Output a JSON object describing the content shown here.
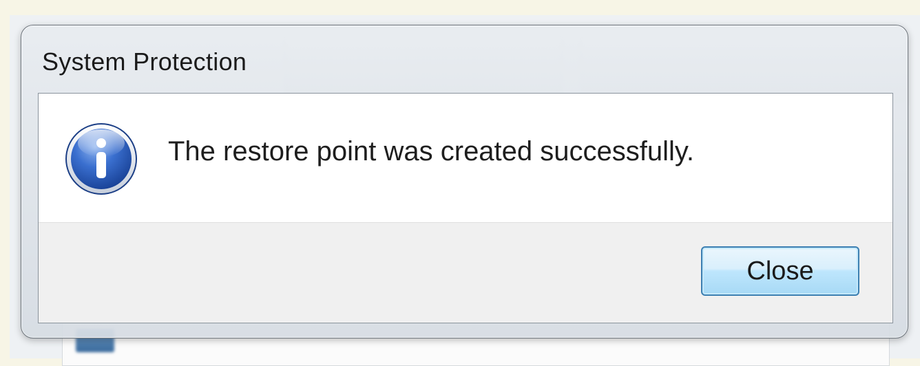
{
  "dialog": {
    "title": "System Protection",
    "message": "The restore point was created successfully.",
    "icon": "info-icon",
    "buttons": {
      "close_label": "Close"
    }
  },
  "colors": {
    "icon_blue": "#2f5fb8",
    "button_border": "#3c7fb1"
  }
}
